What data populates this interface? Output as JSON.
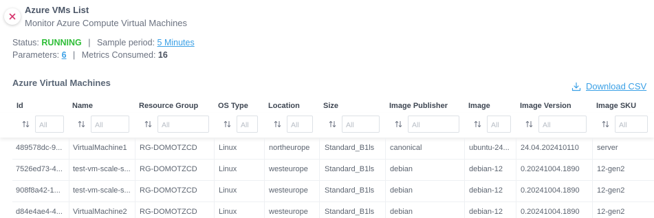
{
  "header": {
    "title": "Azure VMs List",
    "subtitle": "Monitor Azure Compute Virtual Machines"
  },
  "status": {
    "label": "Status:",
    "value": "RUNNING",
    "sample_label": "Sample period:",
    "sample_value": "5 Minutes",
    "params_label": "Parameters:",
    "params_value": "6",
    "metrics_label": "Metrics Consumed:",
    "metrics_value": "16",
    "separator": "|"
  },
  "section": {
    "title": "Azure Virtual Machines",
    "download_label": "Download CSV"
  },
  "filter_placeholder": "All",
  "columns": [
    "Id",
    "Name",
    "Resource Group",
    "OS Type",
    "Location",
    "Size",
    "Image Publisher",
    "Image",
    "Image Version",
    "Image SKU"
  ],
  "rows": [
    [
      "489578dc-9...",
      "VirtualMachine1",
      "RG-DOMOTZCD",
      "Linux",
      "northeurope",
      "Standard_B1ls",
      "canonical",
      "ubuntu-24...",
      "24.04.202410110",
      "server"
    ],
    [
      "7526ed73-4...",
      "test-vm-scale-s...",
      "RG-DOMOTZCD",
      "Linux",
      "westeurope",
      "Standard_B1ls",
      "debian",
      "debian-12",
      "0.20241004.1890",
      "12-gen2"
    ],
    [
      "908f8a42-1...",
      "test-vm-scale-s...",
      "RG-DOMOTZCD",
      "Linux",
      "westeurope",
      "Standard_B1ls",
      "debian",
      "debian-12",
      "0.20241004.1890",
      "12-gen2"
    ],
    [
      "d84e4ae4-4...",
      "VirtualMachine2",
      "RG-DOMOTZCD",
      "Linux",
      "westeurope",
      "Standard_B1ls",
      "debian",
      "debian-12",
      "0.20241004.1890",
      "12-gen2"
    ]
  ],
  "colors": {
    "accent": "#3aa0e6",
    "running": "#2fbe38",
    "close_icon": "#d6336c"
  },
  "icons": {
    "close": "close-icon",
    "download": "download-icon",
    "sort": "sort-icon"
  }
}
